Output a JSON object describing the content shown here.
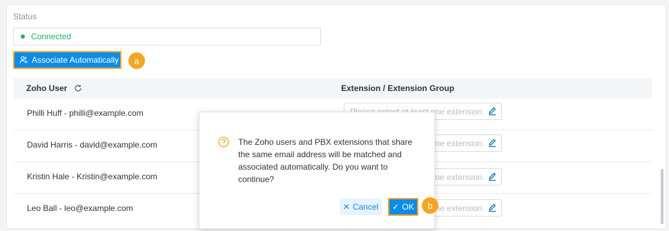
{
  "status": {
    "label": "Status",
    "value": "Connected",
    "color": "#19b55a"
  },
  "toolbar": {
    "associate_label": "Associate Automatically",
    "associate_icon": "users-icon",
    "badge_a": "a"
  },
  "table": {
    "headers": {
      "user": "Zoho User",
      "extension": "Extension / Extension Group"
    },
    "rows": [
      {
        "user": "Philli Huff - philli@example.com",
        "extension_placeholder": "Please select at least one extension."
      },
      {
        "user": "David Harris - david@example.com",
        "extension_placeholder": "Please select at least one extension."
      },
      {
        "user": "Kristin Hale - Kristin@example.com",
        "extension_placeholder": "Please select at least one extension."
      },
      {
        "user": "Leo Ball - leo@example.com",
        "extension_placeholder": "Please select at least one extension."
      }
    ]
  },
  "dialog": {
    "icon": "question-circle-icon",
    "message": "The Zoho users and PBX extensions that share the same email address will be matched and associated automatically. Do you want to continue?",
    "cancel_label": "Cancel",
    "ok_label": "OK",
    "badge_b": "b"
  },
  "colors": {
    "accent": "#0a8ce8",
    "highlight": "#f5a524"
  }
}
